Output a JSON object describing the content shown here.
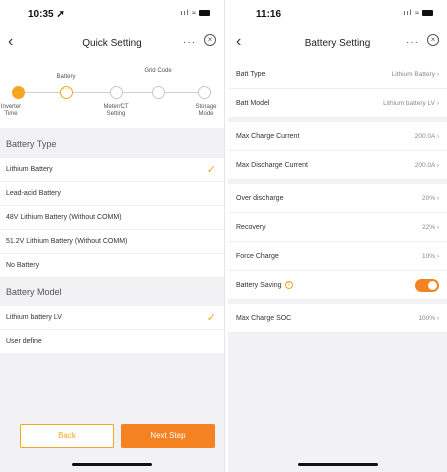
{
  "left": {
    "status": {
      "time": "10:35 ➚",
      "icons": "ııl ≈"
    },
    "nav": {
      "title": "Quick Setting",
      "more": "···"
    },
    "steps": [
      {
        "label": "Inverter Time",
        "state": "done"
      },
      {
        "label": "Battery",
        "state": "current"
      },
      {
        "label": "Meter/CT Setting",
        "state": "todo"
      },
      {
        "label": "Grid Code",
        "state": "todo"
      },
      {
        "label": "Storage Mode",
        "state": "todo"
      }
    ],
    "battery_type_header": "Battery Type",
    "battery_types": [
      {
        "label": "Lithium Battery",
        "selected": true
      },
      {
        "label": "Lead-acid Battery",
        "selected": false
      },
      {
        "label": "48V Lithium Battery (Without COMM)",
        "selected": false
      },
      {
        "label": "51.2V Lithium Battery (Without COMM)",
        "selected": false
      },
      {
        "label": "No Battery",
        "selected": false
      }
    ],
    "battery_model_header": "Battery Model",
    "battery_models": [
      {
        "label": "Lithium battery LV",
        "selected": true
      },
      {
        "label": "User define",
        "selected": false
      }
    ],
    "buttons": {
      "back": "Back",
      "next": "Next Step"
    }
  },
  "right": {
    "status": {
      "time": "11:16",
      "icons": "ııl ≈"
    },
    "nav": {
      "title": "Battery Setting",
      "more": "···"
    },
    "settings": [
      {
        "label": "Batt Type",
        "value": "Lithium Battery"
      },
      {
        "label": "Batt Model",
        "value": "Lithium battery LV"
      },
      {
        "label": "Max Charge Current",
        "value": "200.0A"
      },
      {
        "label": "Max Discharge Current",
        "value": "200.0A"
      },
      {
        "label": "Over discharge",
        "value": "20%"
      },
      {
        "label": "Recovery",
        "value": "22%"
      },
      {
        "label": "Force Charge",
        "value": "10%"
      },
      {
        "label": "Battery Saving",
        "value": ""
      },
      {
        "label": "Max Charge SOC",
        "value": "100%"
      }
    ],
    "battery_saving_enabled": true
  },
  "colors": {
    "accent": "#f58220",
    "accent_light": "#f5a623"
  },
  "icons": {
    "back": "chevron-left-icon",
    "close": "close-circle-icon",
    "check": "check-icon",
    "info": "info-icon"
  }
}
